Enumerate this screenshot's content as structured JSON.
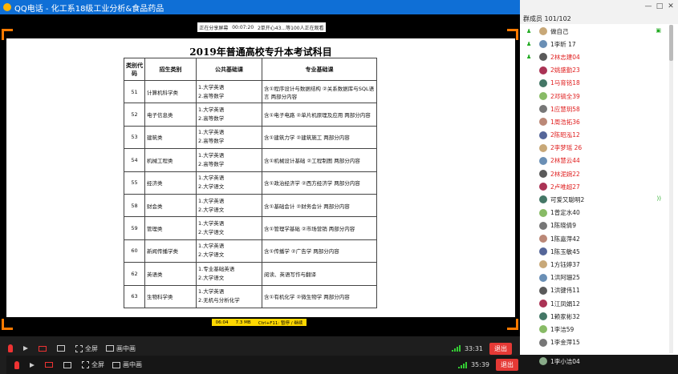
{
  "window": {
    "title": "QQ电话 - 化工系18级工业分析&食品药品",
    "controls": [
      "—",
      "□",
      "✕"
    ]
  },
  "video": {
    "topbar": {
      "sharing": "正在分享屏幕",
      "duration": "00:07:20",
      "status": "2单开心43...等100人正在观看"
    },
    "status": {
      "time": "06:04",
      "size": "7.3 MB",
      "hint": "Ctrl+F11: 暂停 / 继续"
    }
  },
  "document": {
    "title": "2019年普通高校专升本考试科目",
    "headers": [
      "类别代码",
      "招生类别",
      "公共基础课",
      "专业基础课"
    ],
    "rows": [
      {
        "code": "51",
        "category": "计算机科学类",
        "public": [
          "1.大学英语",
          "2.高等数学"
        ],
        "major": "含①程序设计与数据结构 ②关系数据库与SQL语言 两部分内容"
      },
      {
        "code": "52",
        "category": "电子信息类",
        "public": [
          "1.大学英语",
          "2.高等数学"
        ],
        "major": "含①电子电路 ②单片机原理及应用 两部分内容"
      },
      {
        "code": "53",
        "category": "建筑类",
        "public": [
          "1.大学英语",
          "2.高等数学"
        ],
        "major": "含①建筑力学 ②建筑施工 两部分内容"
      },
      {
        "code": "54",
        "category": "机械工程类",
        "public": [
          "1.大学英语",
          "2.高等数学"
        ],
        "major": "含①机械设计基础 ②工程制图 两部分内容"
      },
      {
        "code": "55",
        "category": "经济类",
        "public": [
          "1.大学英语",
          "2.大学语文"
        ],
        "major": "含①政治经济学 ②西方经济学 两部分内容"
      },
      {
        "code": "58",
        "category": "财会类",
        "public": [
          "1.大学英语",
          "2.大学语文"
        ],
        "major": "含①基础会计 ②财务会计 两部分内容"
      },
      {
        "code": "59",
        "category": "管理类",
        "public": [
          "1.大学英语",
          "2.大学语文"
        ],
        "major": "含①管理学基础 ②市场营销 两部分内容"
      },
      {
        "code": "60",
        "category": "新闻传播学类",
        "public": [
          "1.大学英语",
          "2.大学语文"
        ],
        "major": "含①传播学 ②广告学 两部分内容"
      },
      {
        "code": "62",
        "category": "英语类",
        "public": [
          "1.专业基础英语",
          "2.大学语文"
        ],
        "major": "阅读、英语写作与翻译"
      },
      {
        "code": "63",
        "category": "生物科学类",
        "public": [
          "1.大学英语",
          "2.无机与分析化学"
        ],
        "major": "含①有机化学 ②微生物学 两部分内容"
      }
    ]
  },
  "toolbar": {
    "fullscreen": "全屏",
    "pip": "画中画",
    "time1": "33:31",
    "time2": "35:39",
    "exit": "退出"
  },
  "panel": {
    "count": "群成员 101/102",
    "members": [
      {
        "name": "做自己",
        "color": "#222222"
      },
      {
        "name": "1李昕 17",
        "color": "#222222"
      },
      {
        "name": "2林志建04",
        "color": "#e02020"
      },
      {
        "name": "2姚盛勤23",
        "color": "#e02020"
      },
      {
        "name": "1马育铭18",
        "color": "#e02020"
      },
      {
        "name": "2邓镐全39",
        "color": "#e02020"
      },
      {
        "name": "1应慧玥58",
        "color": "#e02020"
      },
      {
        "name": "1周浩拓36",
        "color": "#e02020"
      },
      {
        "name": "2陈昭泓12",
        "color": "#e02020"
      },
      {
        "name": "2李梦瑶 26",
        "color": "#e02020"
      },
      {
        "name": "2林慧云44",
        "color": "#e02020"
      },
      {
        "name": "2林泥婉22",
        "color": "#e02020"
      },
      {
        "name": "2卢唯超27",
        "color": "#e02020"
      },
      {
        "name": "可爱又聪明2",
        "color": "#222222"
      },
      {
        "name": "1曾定水40",
        "color": "#222222"
      },
      {
        "name": "1陈晓倩9",
        "color": "#222222"
      },
      {
        "name": "1陈嘉萍42",
        "color": "#222222"
      },
      {
        "name": "1陈玉敏45",
        "color": "#222222"
      },
      {
        "name": "1方钰婷37",
        "color": "#222222"
      },
      {
        "name": "1洪阿珊25",
        "color": "#222222"
      },
      {
        "name": "1洪键伟11",
        "color": "#222222"
      },
      {
        "name": "1江凤娟12",
        "color": "#222222"
      },
      {
        "name": "1赖家彬32",
        "color": "#222222"
      },
      {
        "name": "1李洁59",
        "color": "#222222"
      },
      {
        "name": "1李金萍15",
        "color": "#222222"
      }
    ],
    "extra_member": "1李小洁04"
  }
}
